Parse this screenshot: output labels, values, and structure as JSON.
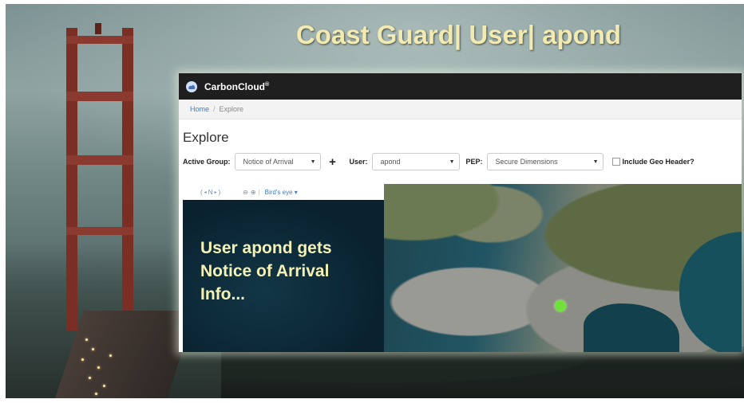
{
  "slide": {
    "title": "Coast Guard| User| apond"
  },
  "app": {
    "brand": "CarbonCloud",
    "brand_mark": "®",
    "logo_icon": "cloud-logo-icon",
    "breadcrumb": {
      "home": "Home",
      "separator": "/",
      "current": "Explore"
    },
    "page_title": "Explore",
    "filters": {
      "active_group_label": "Active Group:",
      "active_group_value": "Notice of Arrival",
      "add_label": "+",
      "user_label": "User:",
      "user_value": "apond",
      "pep_label": "PEP:",
      "pep_value": "Secure Dimensions",
      "geo_header_label": "Include Geo Header?",
      "geo_header_checked": false
    },
    "map": {
      "compass_label": "N",
      "birds_eye_label": "Bird's eye ▾",
      "caption": "User apond gets\nNotice of Arrival\nInfo...",
      "marker_color": "#6fe23a"
    }
  }
}
